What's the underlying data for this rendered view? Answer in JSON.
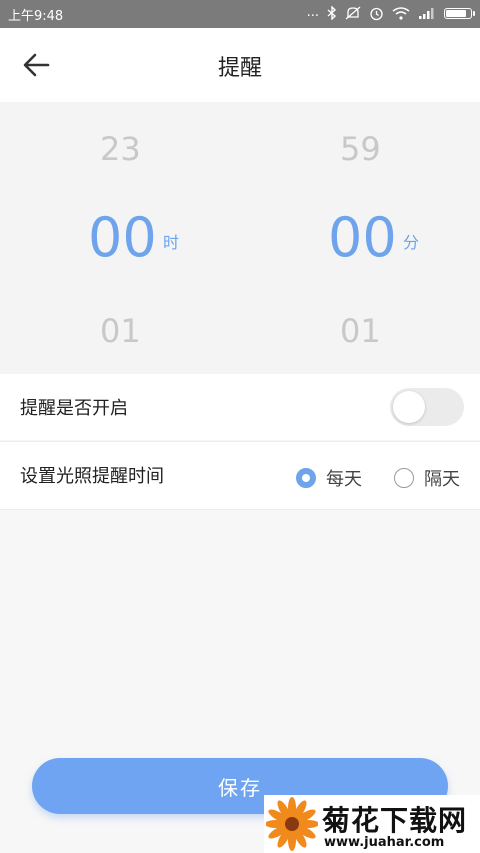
{
  "status_bar": {
    "time": "上午9:48",
    "dots": "...",
    "battery_level": 0.9
  },
  "header": {
    "title": "提醒",
    "back_icon": "arrow-left-icon"
  },
  "picker": {
    "hours": {
      "prev": "23",
      "selected": "00",
      "next": "01",
      "unit": "时"
    },
    "minutes": {
      "prev": "59",
      "selected": "00",
      "next": "01",
      "unit": "分"
    }
  },
  "settings": {
    "reminder_label": "提醒是否开启",
    "reminder_enabled": false,
    "interval_label": "设置光照提醒时间",
    "options": [
      {
        "label": "每天",
        "selected": true
      },
      {
        "label": "隔天",
        "selected": false
      }
    ]
  },
  "save_label": "保存",
  "watermark": {
    "title": "菊花下载网",
    "url": "www.juahar.com"
  },
  "colors": {
    "accent": "#6ea4ec",
    "button": "#6ea4f2",
    "status_bar": "#7b7b7b"
  }
}
